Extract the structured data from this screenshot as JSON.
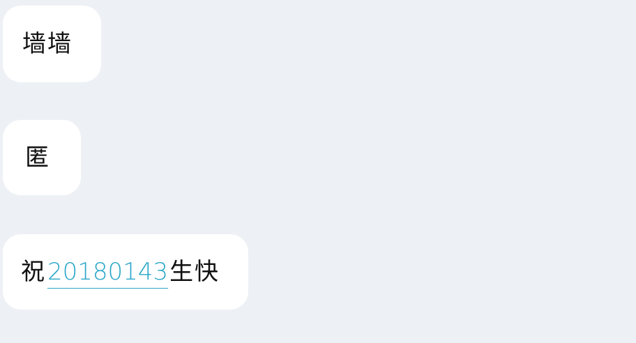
{
  "messages": [
    {
      "text": "墙墙"
    },
    {
      "text": "匿"
    },
    {
      "prefix": "祝",
      "link": "20180143",
      "suffix": "生快"
    }
  ],
  "colors": {
    "background": "#edf1f5",
    "bubble": "#ffffff",
    "text": "#111111",
    "link": "#2aa6c8"
  }
}
